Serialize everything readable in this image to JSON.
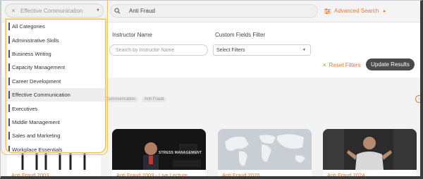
{
  "category_select": {
    "value": "Effective Communication",
    "clear_icon": "×",
    "chevron_icon": "▼"
  },
  "search": {
    "value": "Anti Fraud",
    "icon": "search-icon"
  },
  "advanced_search": {
    "label": "Advanced Search",
    "caret": "▲"
  },
  "filters": {
    "instructor_label": "Instructor Name",
    "instructor_placeholder": "Search by Instructor Name",
    "custom_label": "Custom Fields Filter",
    "custom_value": "Select Filters",
    "custom_chevron": "▼",
    "reset_label": "Reset Filters",
    "reset_icon": "×",
    "update_label": "Update Results"
  },
  "active_tags": [
    "Communication",
    "Anti Fraud"
  ],
  "next_arrow": "›",
  "dropdown": {
    "items": [
      "All Categories",
      "Administrative Skills",
      "Business Writing",
      "Capacity Management",
      "Career Development",
      "Effective Communication",
      "Executives",
      "Middle Management",
      "Sales and Marketing",
      "Workplace Essentials"
    ],
    "selected_index": 5
  },
  "cards": [
    {
      "title": "Anti Fraud 2003"
    },
    {
      "title": "Anti Fraud 2003 - Live Lecture",
      "thumb_text": "STRESS MANAGEMENT"
    },
    {
      "title": "Anti Fraud 2020"
    },
    {
      "title": "Anti Fraud 2024"
    }
  ],
  "colors": {
    "accent": "#e07a35",
    "dark_button": "#4a4a4a",
    "highlight": "#f4c34e"
  }
}
